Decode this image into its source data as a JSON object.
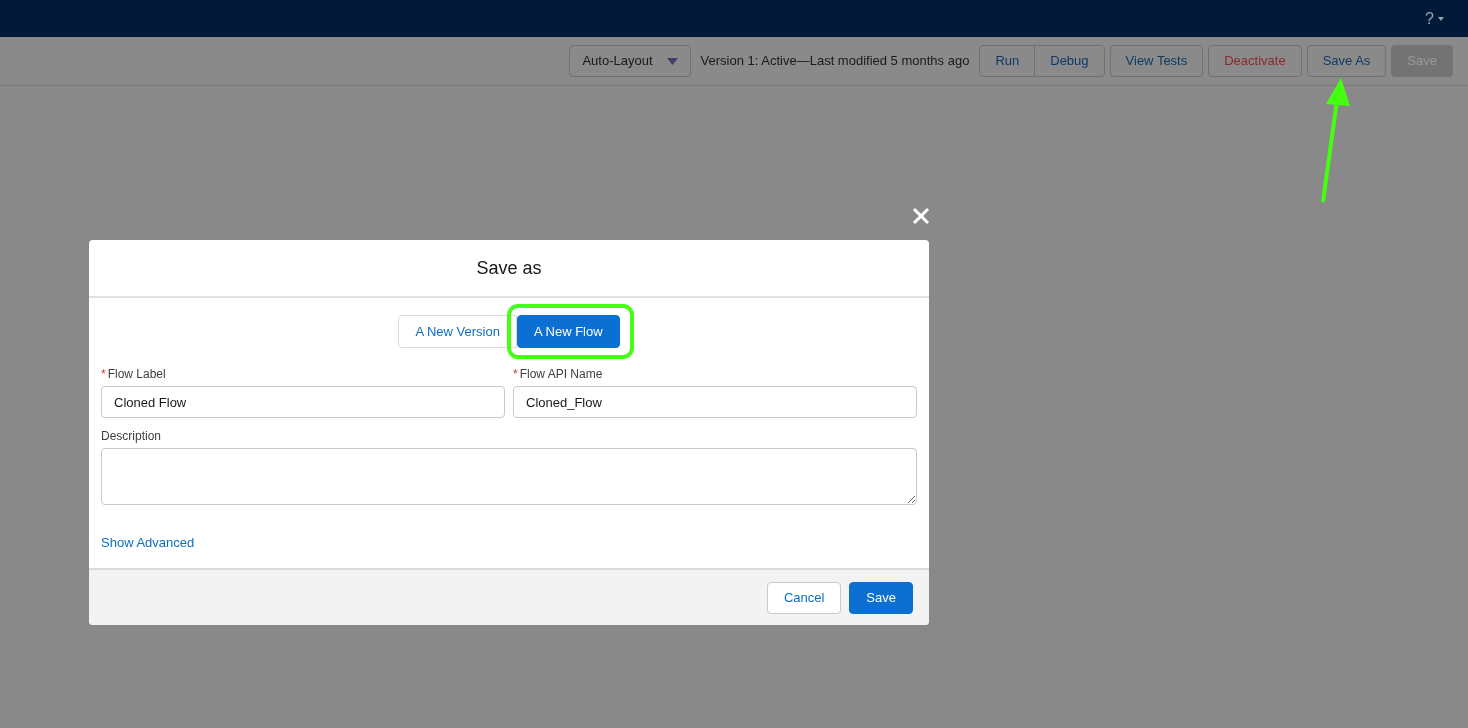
{
  "header": {
    "help_menu": "?"
  },
  "toolbar": {
    "layout_select": "Auto-Layout",
    "version_status": "Version 1: Active—Last modified 5 months ago",
    "buttons": [
      {
        "label": "Run",
        "kind": "grouped",
        "disabled": false
      },
      {
        "label": "Debug",
        "kind": "grouped",
        "disabled": false
      },
      {
        "label": "View Tests",
        "kind": "neutral",
        "disabled": false
      },
      {
        "label": "Deactivate",
        "kind": "destructive",
        "disabled": false
      },
      {
        "label": "Save As",
        "kind": "neutral",
        "disabled": false
      },
      {
        "label": "Save",
        "kind": "neutral",
        "disabled": true
      }
    ]
  },
  "modal": {
    "title": "Save as",
    "options": [
      {
        "label": "A New Version",
        "selected": false
      },
      {
        "label": "A New Flow",
        "selected": true
      }
    ],
    "fields": [
      {
        "required_mark": "*",
        "label": "Flow Label",
        "value": "Cloned Flow"
      },
      {
        "required_mark": "*",
        "label": "Flow API Name",
        "value": "Cloned_Flow"
      }
    ],
    "description": {
      "label": "Description"
    },
    "link": "Show Advanced",
    "footer_buttons": [
      {
        "label": "Cancel",
        "kind": "neutral"
      },
      {
        "label": "Save",
        "kind": "brand"
      }
    ]
  }
}
